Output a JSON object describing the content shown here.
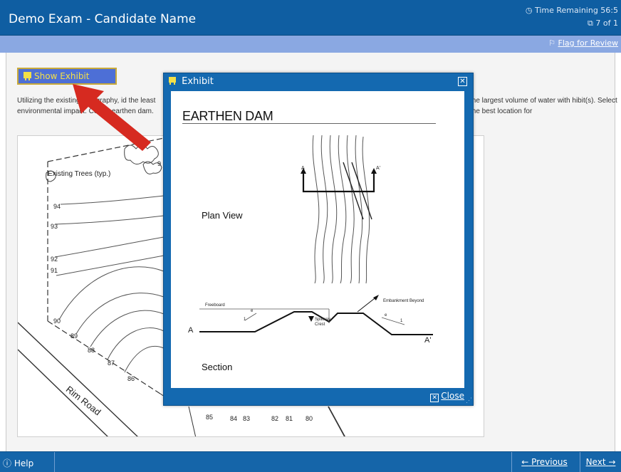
{
  "header": {
    "title": "Demo Exam - Candidate Name",
    "timer_icon": "clock-icon",
    "time_remaining": "Time Remaining 56:5",
    "question_icon": "pages-icon",
    "progress": "7 of 1"
  },
  "toolbar": {
    "flag_icon": "flag-icon",
    "flag_label": "Flag for Review"
  },
  "exhibit_button": {
    "icon": "exhibit-icon",
    "label": "Show Exhibit"
  },
  "question": {
    "left_text": "Utilizing the existing topography, id the least environmental impact. Co the earthen dam.",
    "right_text": "the largest volume of water with hibit(s). Select the best location for"
  },
  "site_map": {
    "trees_label": "Existing Trees (typ.)",
    "road_label": "Rim Road",
    "contours_left": [
      "94",
      "93",
      "92",
      "91",
      "90"
    ],
    "contours_diagonal": [
      "89",
      "88",
      "87",
      "86"
    ],
    "contours_bottom": [
      "85",
      "84",
      "83",
      "82",
      "81",
      "80"
    ],
    "partial_label": "9"
  },
  "exhibit_window": {
    "title": "Exhibit",
    "title_icon": "exhibit-icon",
    "close_x_icon": "close-icon",
    "heading": "EARTHEN DAM",
    "plan_view_label": "Plan View",
    "section_label": "Section",
    "section_mark_a": "A",
    "section_mark_a_prime": "A'",
    "freeboard_label": "Freeboard",
    "embankment_label": "Embankment Beyond",
    "spillway_label": "Spillway Crest",
    "slope_run": "1",
    "slope_rise": "e",
    "close_label": "Close",
    "close_icon": "close-icon"
  },
  "footer": {
    "help_icon": "help-icon",
    "help_label": "Help",
    "previous_label": "Previous",
    "next_label": "Next",
    "previous_icon": "arrow-left-icon",
    "next_icon": "arrow-right-icon"
  },
  "colors": {
    "header_bg": "#0f5ea2",
    "subbar_bg": "#8aa8e2",
    "footer_bg": "#1565a9",
    "arrow_red": "#d62a20",
    "exhibit_button_text": "#f4e048"
  }
}
